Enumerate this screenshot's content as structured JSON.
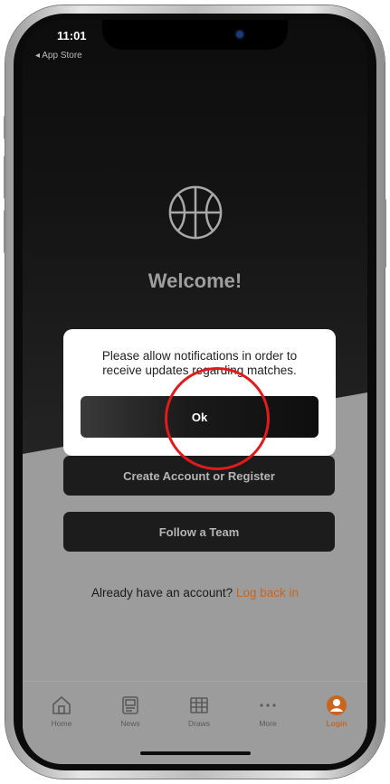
{
  "status_bar": {
    "time": "11:01",
    "back_label": "◂ App Store"
  },
  "welcome": {
    "title": "Welcome!"
  },
  "dialog": {
    "message": "Please allow notifications in order to receive updates regarding matches.",
    "ok_label": "Ok"
  },
  "actions": {
    "create_account_label": "Create Account or Register",
    "follow_team_label": "Follow a Team"
  },
  "login_prompt": {
    "text": "Already have an account?",
    "link": "Log back in"
  },
  "tabbar": {
    "items": [
      {
        "label": "Home",
        "icon": "home-icon"
      },
      {
        "label": "News",
        "icon": "news-icon"
      },
      {
        "label": "Draws",
        "icon": "draws-icon"
      },
      {
        "label": "More",
        "icon": "more-icon"
      },
      {
        "label": "Login",
        "icon": "user-icon",
        "active": true
      }
    ]
  },
  "colors": {
    "accent": "#c9651e",
    "highlight_ring": "#e01b1b"
  }
}
